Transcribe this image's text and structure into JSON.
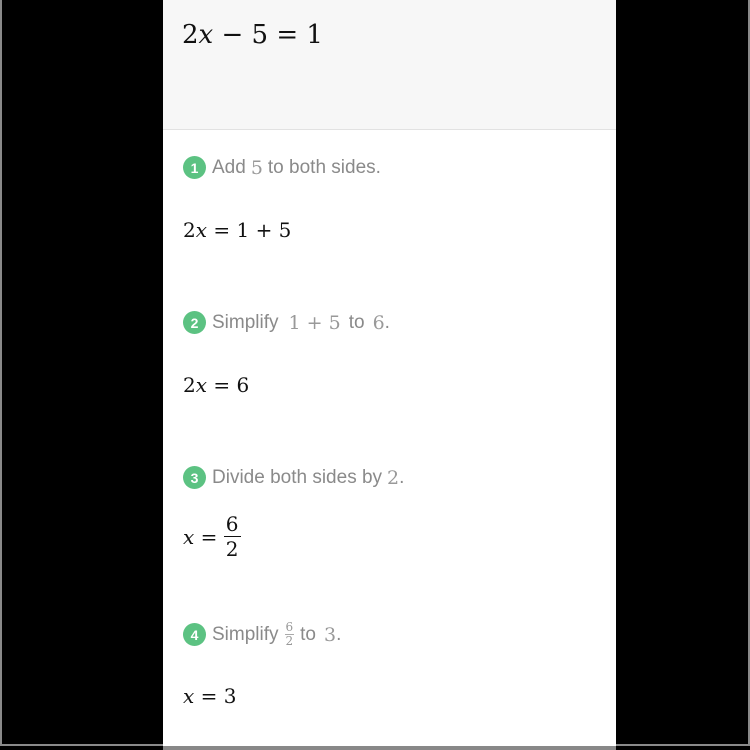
{
  "problem": {
    "equation": {
      "lhs": "2x − 5",
      "rhs": "1"
    },
    "parts": [
      "2",
      "x",
      " − 5 = 1"
    ]
  },
  "steps": [
    {
      "number": "1",
      "label_parts": [
        "Add",
        "5",
        "to both sides."
      ],
      "result": [
        "2",
        "x",
        " = 1 + 5"
      ]
    },
    {
      "number": "2",
      "label_parts": [
        "Simplify",
        "1 + 5",
        "to",
        "6",
        "."
      ],
      "result": [
        "2",
        "x",
        " = 6"
      ]
    },
    {
      "number": "3",
      "label_parts": [
        "Divide both sides by",
        "2",
        "."
      ],
      "result": {
        "var": "x",
        "eq": " = ",
        "numerator": "6",
        "denominator": "2"
      }
    },
    {
      "number": "4",
      "label_parts": [
        "Simplify",
        "6",
        "2",
        "to",
        "3",
        "."
      ],
      "result": [
        "x",
        " = 3"
      ]
    }
  ],
  "colors": {
    "badge": "#5cc282",
    "label": "#8a8a8a",
    "header_bg": "#f7f7f7"
  }
}
